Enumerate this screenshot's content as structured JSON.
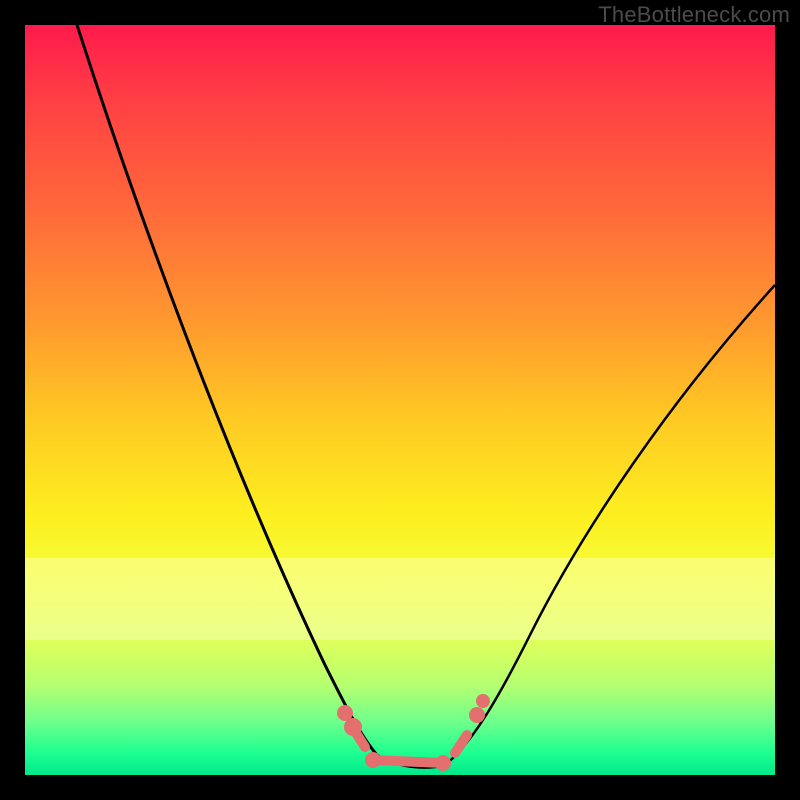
{
  "watermark": "TheBottleneck.com",
  "colors": {
    "curve": "#000000",
    "bead": "#e36f6f",
    "background_border": "#000000"
  },
  "chart_data": {
    "type": "line",
    "title": "",
    "xlabel": "",
    "ylabel": "",
    "xlim": [
      0,
      100
    ],
    "ylim": [
      0,
      100
    ],
    "series": [
      {
        "name": "bottleneck-curve",
        "x": [
          7,
          12,
          18,
          24,
          30,
          35,
          38,
          41,
          43,
          46,
          50,
          54,
          57,
          60,
          65,
          72,
          80,
          88,
          96,
          100
        ],
        "y": [
          100,
          85,
          68,
          53,
          38,
          25,
          16,
          9,
          5,
          2,
          0.5,
          2,
          5,
          10,
          20,
          32,
          44,
          54,
          62,
          66
        ]
      }
    ],
    "highlight_region": {
      "name": "optimal-zone-beads",
      "x_range": [
        41,
        59
      ],
      "y_value": 1
    },
    "background": "rainbow-gradient-red-to-green"
  }
}
